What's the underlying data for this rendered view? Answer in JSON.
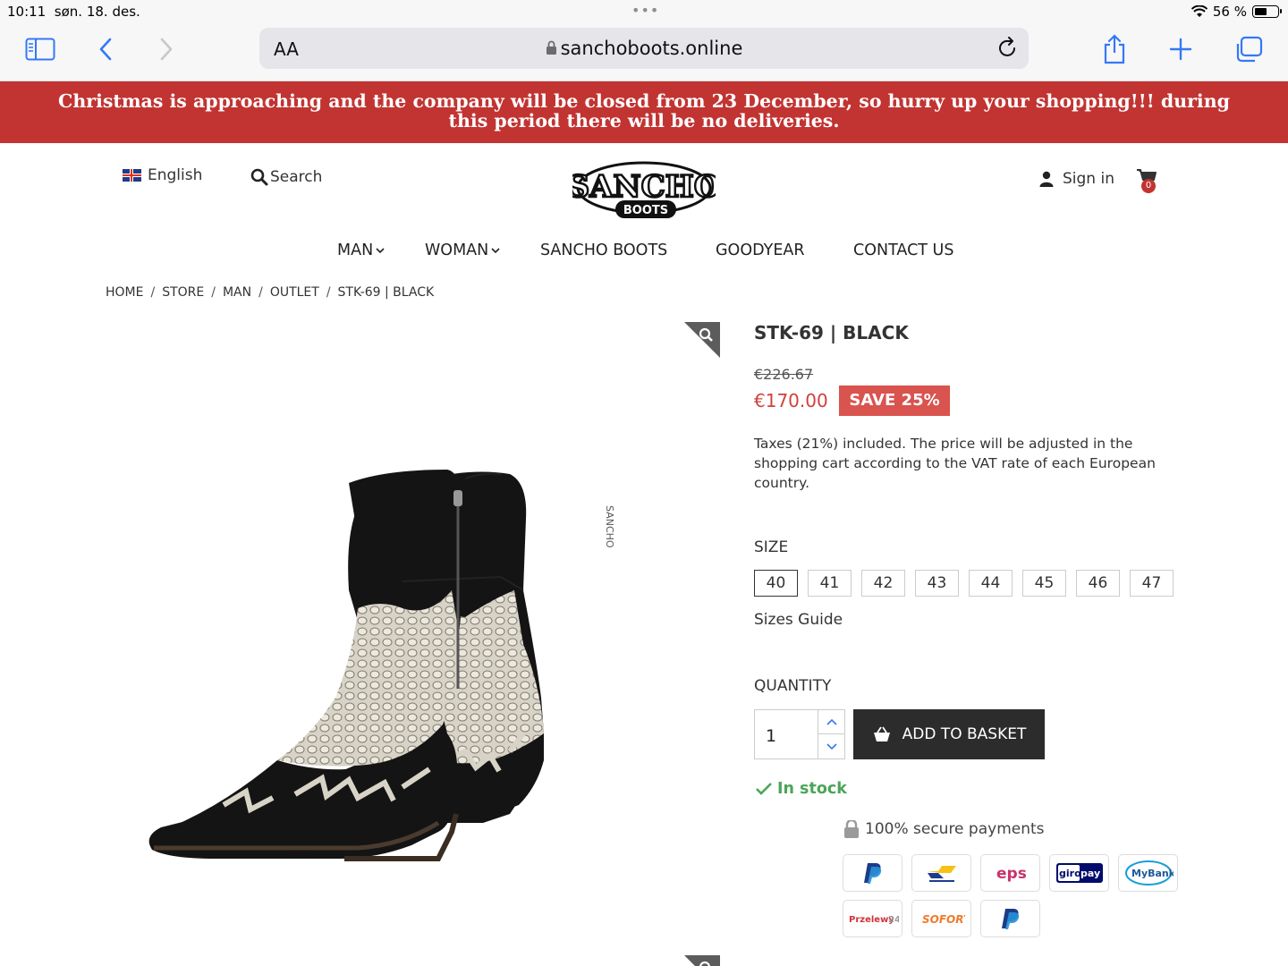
{
  "status": {
    "time": "10:11",
    "date": "søn. 18. des.",
    "battery": "56 %",
    "battery_level": 0.56
  },
  "browser": {
    "aa": "AA",
    "url": "sanchoboots.online"
  },
  "banner": {
    "text": "Christmas is approaching and the company will be closed from 23 December, so hurry up your shopping!!! during this period there will be no deliveries.",
    "color": "#c13432"
  },
  "header": {
    "language": "English",
    "search_label": "Search",
    "logo": {
      "name": "SANCHO",
      "sub": "BOOTS"
    },
    "signin": "Sign in",
    "cart_count": "0"
  },
  "nav": {
    "items": [
      "MAN",
      "WOMAN",
      "SANCHO BOOTS",
      "GOODYEAR",
      "CONTACT US"
    ]
  },
  "breadcrumb": [
    "HOME",
    "STORE",
    "MAN",
    "OUTLET",
    "STK-69 | BLACK"
  ],
  "product": {
    "title": "STK-69 | BLACK",
    "old_price": "€226.67",
    "price": "€170.00",
    "save": "SAVE 25%",
    "tax_note": "Taxes (21%) included. The price will be adjusted in the shopping cart according to the VAT rate of each European country.",
    "size_label": "SIZE",
    "sizes": [
      "40",
      "41",
      "42",
      "43",
      "44",
      "45",
      "46",
      "47"
    ],
    "selected_size": "40",
    "sizes_guide": "Sizes Guide",
    "quantity_label": "QUANTITY",
    "quantity": "1",
    "add_to_basket": "ADD TO BASKET",
    "stock": "In stock",
    "secure": "100% secure payments",
    "image_lettering": "SANCHO"
  },
  "payments": [
    "PayPal",
    "Bancontact",
    "eps",
    "giropay",
    "MyBank",
    "Przelewy24",
    "SOFORT",
    "PayPal"
  ],
  "colors": {
    "accent": "#c13432",
    "price": "#d0413a",
    "stock": "#4aa657",
    "button": "#2c2c2c",
    "ios_blue": "#3478f6"
  }
}
